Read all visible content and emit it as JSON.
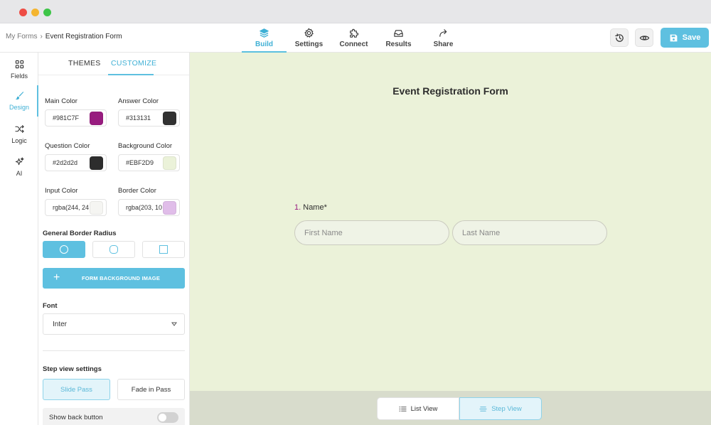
{
  "window": {
    "controls": [
      "close",
      "minimize",
      "maximize"
    ]
  },
  "breadcrumb": {
    "root": "My Forms",
    "separator": "›",
    "current": "Event Registration Form"
  },
  "nav": {
    "tabs": [
      {
        "label": "Build",
        "icon": "layers-icon",
        "active": true
      },
      {
        "label": "Settings",
        "icon": "gear-icon",
        "active": false
      },
      {
        "label": "Connect",
        "icon": "puzzle-icon",
        "active": false
      },
      {
        "label": "Results",
        "icon": "inbox-icon",
        "active": false
      },
      {
        "label": "Share",
        "icon": "share-arrow-icon",
        "active": false
      }
    ]
  },
  "toolbar": {
    "save_label": "Save"
  },
  "leftrail": {
    "items": [
      {
        "label": "Fields",
        "icon": "grid-icon",
        "active": false
      },
      {
        "label": "Design",
        "icon": "brush-icon",
        "active": true
      },
      {
        "label": "Logic",
        "icon": "shuffle-icon",
        "active": false
      },
      {
        "label": "AI",
        "icon": "sparkle-icon",
        "active": false
      }
    ]
  },
  "panel": {
    "tabs": {
      "themes": "THEMES",
      "customize": "CUSTOMIZE",
      "active": "CUSTOMIZE"
    },
    "colors": {
      "main": {
        "label": "Main Color",
        "value": "#981C7F",
        "swatch": "#981c7f"
      },
      "answer": {
        "label": "Answer Color",
        "value": "#313131",
        "swatch": "#313131"
      },
      "question": {
        "label": "Question Color",
        "value": "#2d2d2d",
        "swatch": "#2d2d2d"
      },
      "background": {
        "label": "Background Color",
        "value": "#EBF2D9",
        "swatch": "#ebf2d9"
      },
      "input": {
        "label": "Input Color",
        "value": "rgba(244, 24",
        "swatch": "#f5f5f2"
      },
      "border": {
        "label": "Border Color",
        "value": "rgba(203, 10",
        "swatch": "#e0bde9"
      }
    },
    "border_radius": {
      "label": "General Border Radius",
      "selected": "round",
      "options": [
        "round",
        "rounded",
        "square"
      ]
    },
    "bg_image_button": {
      "plus": "+",
      "label": "FORM BACKGROUND IMAGE"
    },
    "font": {
      "label": "Font",
      "value": "Inter"
    },
    "step_view": {
      "label": "Step view settings",
      "options": [
        "Slide Pass",
        "Fade in Pass"
      ],
      "selected": "Slide Pass"
    },
    "back_button": {
      "label": "Show back button",
      "enabled": false
    }
  },
  "form": {
    "title": "Event Registration Form",
    "question": {
      "number": "1.",
      "label": "Name",
      "required_mark": "*"
    },
    "first_name_placeholder": "First Name",
    "last_name_placeholder": "Last Name"
  },
  "views": {
    "list": "List View",
    "step": "Step View",
    "active": "Step View"
  },
  "colors": {
    "accent": "#5ec0e0",
    "canvas": "#ebf2d9",
    "main": "#981c7f"
  }
}
